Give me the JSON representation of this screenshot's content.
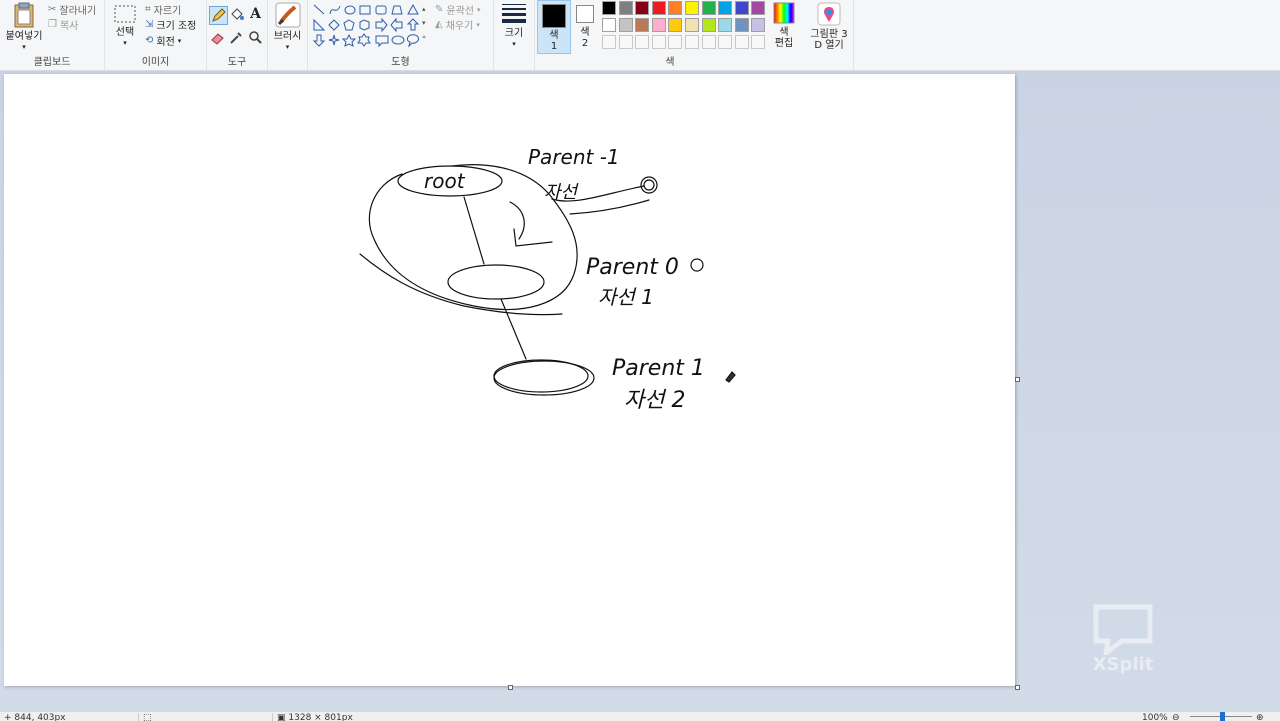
{
  "ribbon": {
    "clipboard": {
      "paste_label": "붙여넣기",
      "cut_label": "잘라내기",
      "copy_label": "복사",
      "group_label": "클립보드"
    },
    "image": {
      "select_label": "선택",
      "crop_label": "자르기",
      "resize_label": "크기 조정",
      "rotate_label": "회전",
      "group_label": "이미지"
    },
    "tools": {
      "group_label": "도구"
    },
    "brushes": {
      "label": "브러시"
    },
    "shapes": {
      "outline_label": "윤곽선",
      "fill_label": "채우기",
      "group_label": "도형"
    },
    "size": {
      "label": "크기"
    },
    "colors": {
      "color1_label": "색",
      "color1_num": "1",
      "color2_label": "색",
      "color2_num": "2",
      "edit_label_1": "색",
      "edit_label_2": "편집",
      "group_label": "색",
      "color1": "#000000",
      "color2": "#ffffff",
      "palette_row1": [
        "#000000",
        "#7f7f7f",
        "#880015",
        "#ed1c24",
        "#ff7f27",
        "#fff200",
        "#22b14c",
        "#00a2e8",
        "#3f48cc",
        "#a349a4"
      ],
      "palette_row2": [
        "#ffffff",
        "#c3c3c3",
        "#b97a57",
        "#ffaec9",
        "#ffc90e",
        "#efe4b0",
        "#b5e61d",
        "#99d9ea",
        "#7092be",
        "#c8bfe7"
      ]
    },
    "paint3d": {
      "label_1": "그림판 3",
      "label_2": "D 열기"
    }
  },
  "canvas": {
    "texts": {
      "root": "root",
      "parent_m1": "Parent -1",
      "child_0": "자선",
      "parent_0": "Parent 0",
      "child_1": "자선 1",
      "parent_1": "Parent 1",
      "child_2": "자선 2"
    }
  },
  "watermark": {
    "text": "XSplit"
  },
  "status": {
    "cursor_pos": "844, 403px",
    "canvas_size": "1328 × 801px",
    "zoom": "100%"
  }
}
